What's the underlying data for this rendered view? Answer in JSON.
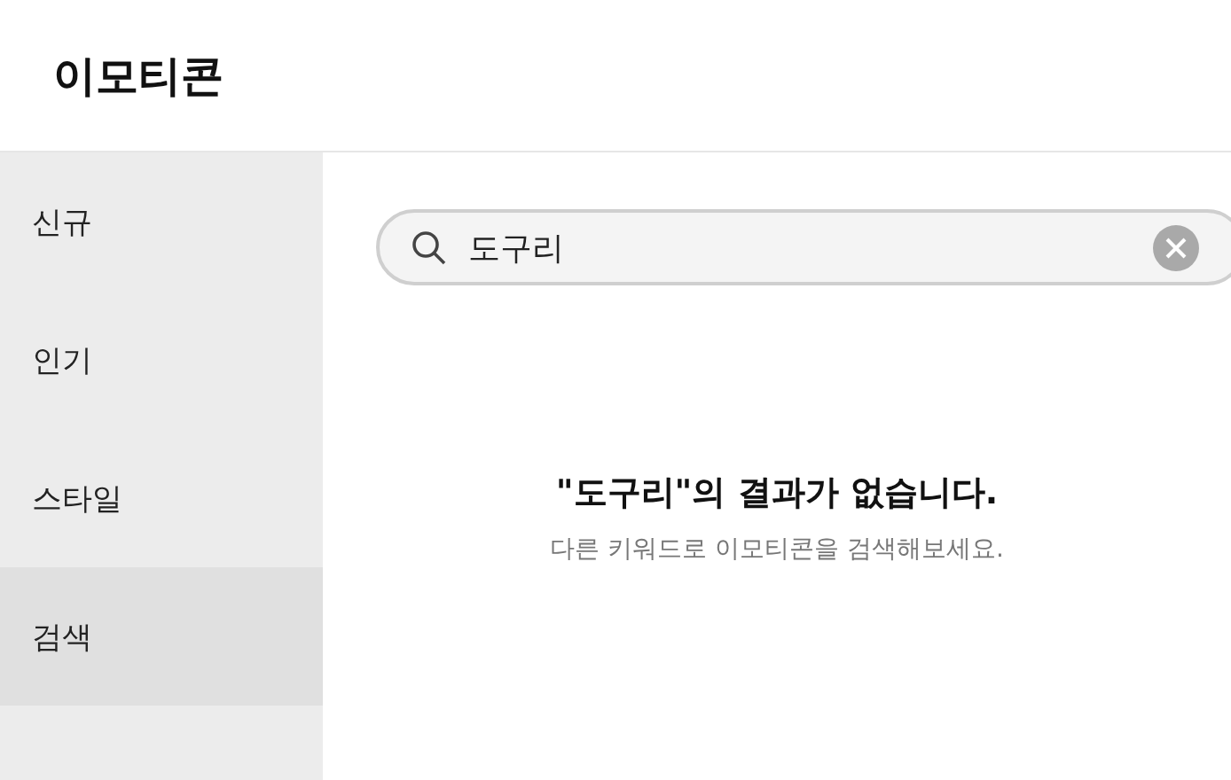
{
  "header": {
    "title": "이모티콘"
  },
  "sidebar": {
    "items": [
      {
        "label": "신규",
        "selected": false
      },
      {
        "label": "인기",
        "selected": false
      },
      {
        "label": "스타일",
        "selected": false
      },
      {
        "label": "검색",
        "selected": true
      }
    ]
  },
  "search": {
    "value": "도구리"
  },
  "empty_state": {
    "title": "\"도구리\"의 결과가 없습니다.",
    "message": "다른 키워드로 이모티콘을 검색해보세요."
  }
}
